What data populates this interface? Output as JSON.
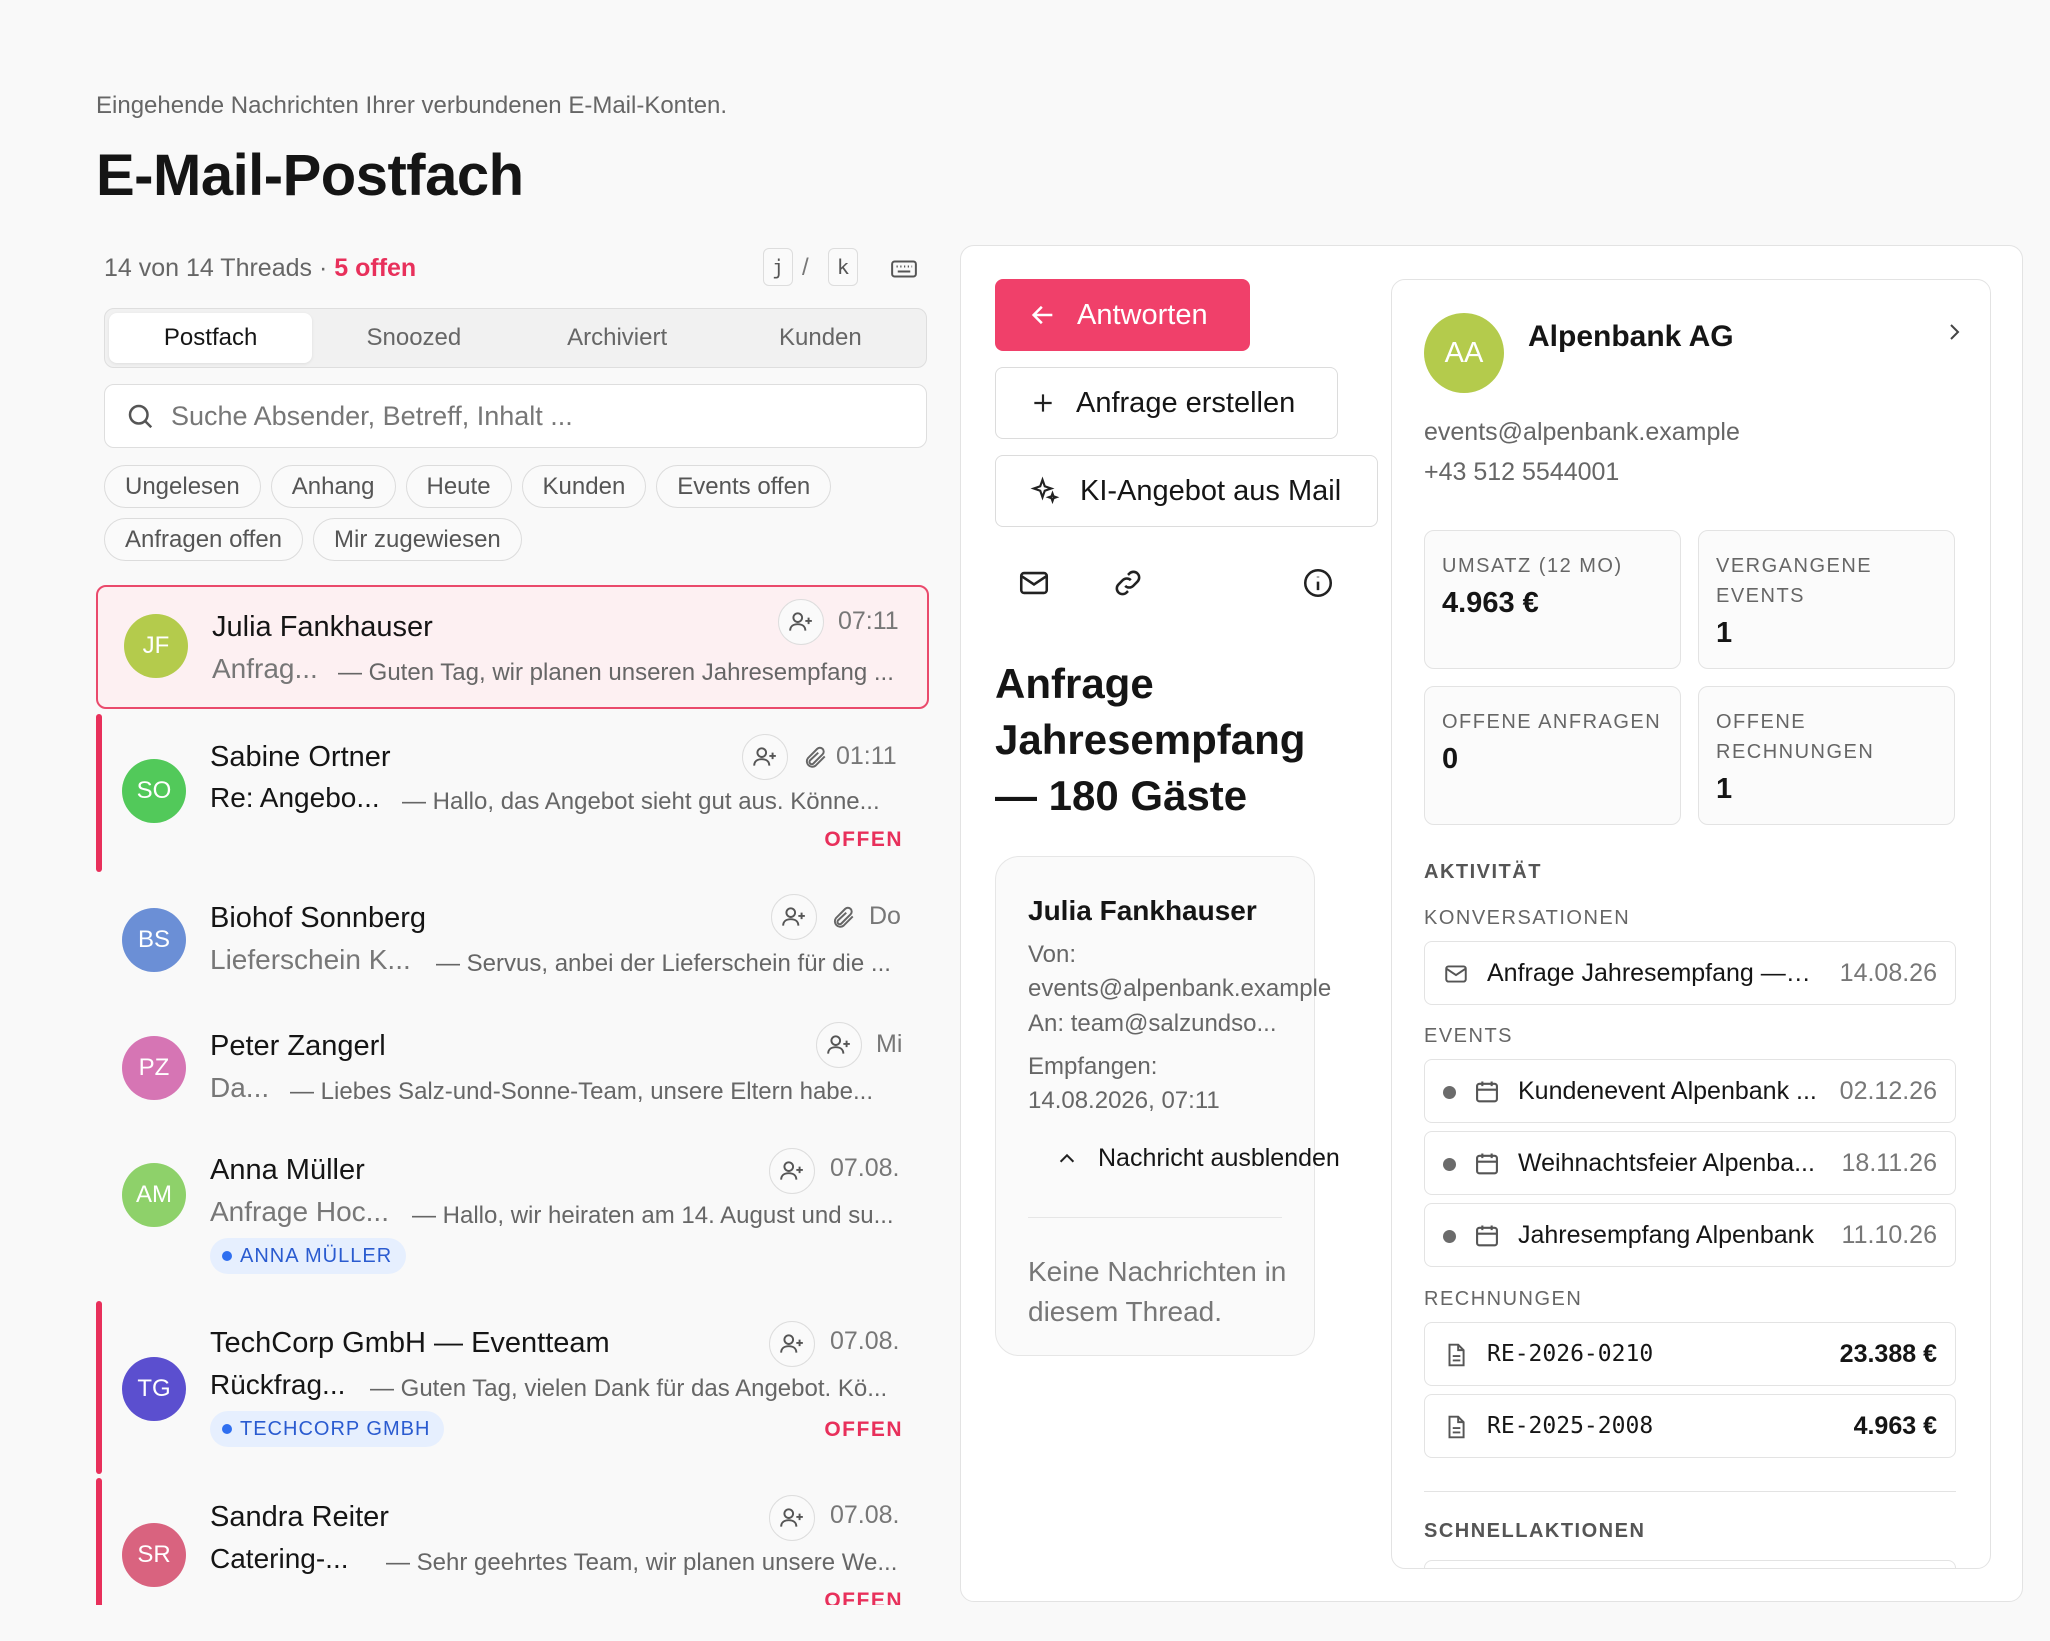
{
  "header": {
    "subtitle": "Eingehende Nachrichten Ihrer verbundenen E-Mail-Konten.",
    "title": "E-Mail-Postfach"
  },
  "list": {
    "count_text": "14 von 14 Threads · ",
    "open_text": "5 offen",
    "kbd_prev": "j",
    "kbd_sep": "/",
    "kbd_next": "k",
    "tabs": [
      "Postfach",
      "Snoozed",
      "Archiviert",
      "Kunden"
    ],
    "active_tab": "Postfach",
    "search_placeholder": "Suche Absender, Betreff, Inhalt ...",
    "filters": [
      "Ungelesen",
      "Anhang",
      "Heute",
      "Kunden",
      "Events offen",
      "Anfragen offen",
      "Mir zugewiesen"
    ],
    "threads": [
      {
        "initials": "JF",
        "color": "#b4cb4c",
        "name": "Julia Fankhauser",
        "subject": "Anfrag...",
        "preview": "— Guten Tag, wir planen unseren Jahresempfang ...",
        "time": "07:11",
        "attachment": false,
        "status": "",
        "tag": ""
      },
      {
        "initials": "SO",
        "color": "#52c95a",
        "name": "Sabine Ortner",
        "subject": "Re: Angebo...",
        "preview": "— Hallo, das Angebot sieht gut aus. Könne...",
        "time": "01:11",
        "attachment": true,
        "status": "OFFEN",
        "tag": ""
      },
      {
        "initials": "BS",
        "color": "#6b8fd6",
        "name": "Biohof Sonnberg",
        "subject": "Lieferschein K...",
        "preview": "— Servus, anbei der Lieferschein für die ...",
        "time": "Do",
        "attachment": true,
        "status": "",
        "tag": ""
      },
      {
        "initials": "PZ",
        "color": "#d675b4",
        "name": "Peter Zangerl",
        "subject": "Da...",
        "preview": "— Liebes Salz-und-Sonne-Team, unsere Eltern habe...",
        "time": "Mi",
        "attachment": false,
        "status": "",
        "tag": ""
      },
      {
        "initials": "AM",
        "color": "#8ed16a",
        "name": "Anna Müller",
        "subject": "Anfrage Hoc...",
        "preview": "— Hallo, wir heiraten am 14. August und su...",
        "time": "07.08.",
        "attachment": false,
        "status": "",
        "tag": "ANNA MÜLLER"
      },
      {
        "initials": "TG",
        "color": "#5b4fcf",
        "name": "TechCorp GmbH — Eventteam",
        "subject": "Rückfrag...",
        "preview": "— Guten Tag, vielen Dank für das Angebot. Kö...",
        "time": "07.08.",
        "attachment": false,
        "status": "OFFEN",
        "tag": "TECHCORP GMBH"
      },
      {
        "initials": "SR",
        "color": "#d9637f",
        "name": "Sandra Reiter",
        "subject": "Catering-...",
        "preview": "— Sehr geehrtes Team, wir planen unsere We...",
        "time": "07.08.",
        "attachment": false,
        "status": "OFFEN",
        "tag": ""
      }
    ]
  },
  "detail": {
    "reply_label": "Antworten",
    "create_request_label": "Anfrage erstellen",
    "ai_offer_label": "KI-Angebot aus Mail",
    "subject": "Anfrage Jahresempfang — 180 Gäste",
    "message": {
      "sender": "Julia Fankhauser",
      "from_label": "Von:",
      "from": "events@alpenbank.example",
      "to": "An: team@salzundso...",
      "received_label": "Empfangen:",
      "received": "14.08.2026, 07:11",
      "toggle_label": "Nachricht ausblenden",
      "empty_text": "Keine Nachrichten in diesem Thread."
    }
  },
  "customer": {
    "initials": "AA",
    "name": "Alpenbank AG",
    "email": "events@alpenbank.example",
    "phone": "+43 512 5544001",
    "stats": [
      {
        "label": "UMSATZ (12 MO)",
        "value": "4.963 €"
      },
      {
        "label": "VERGANGENE EVENTS",
        "value": "1"
      },
      {
        "label": "OFFENE ANFRAGEN",
        "value": "0"
      },
      {
        "label": "OFFENE RECHNUNGEN",
        "value": "1"
      }
    ],
    "activity_heading": "AKTIVITÄT",
    "conversations_heading": "KONVERSATIONEN",
    "conversations": [
      {
        "title": "Anfrage Jahresempfang — 1...",
        "date": "14.08.26"
      }
    ],
    "events_heading": "EVENTS",
    "events": [
      {
        "title": "Kundenevent Alpenbank ...",
        "date": "02.12.26"
      },
      {
        "title": "Weihnachtsfeier Alpenba...",
        "date": "18.11.26"
      },
      {
        "title": "Jahresempfang Alpenbank",
        "date": "11.10.26"
      }
    ],
    "invoices_heading": "RECHNUNGEN",
    "invoices": [
      {
        "number": "RE-2026-0210",
        "amount": "23.388 €"
      },
      {
        "number": "RE-2025-2008",
        "amount": "4.963 €"
      }
    ],
    "quick_actions_heading": "SCHNELLAKTIONEN"
  }
}
